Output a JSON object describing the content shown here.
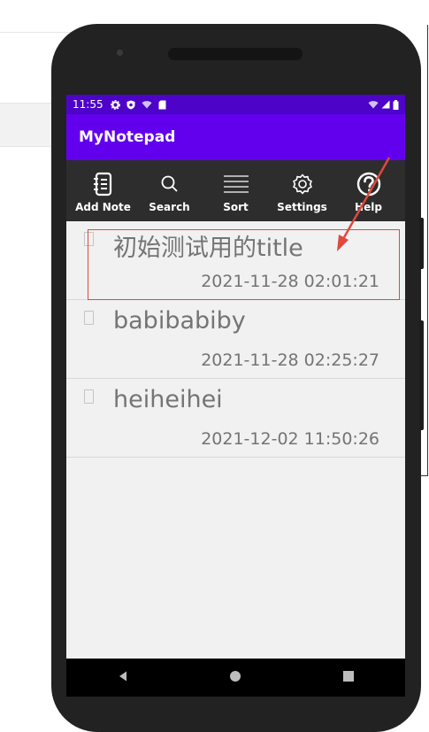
{
  "status_bar": {
    "time": "11:55"
  },
  "app": {
    "title": "MyNotepad"
  },
  "toolbar": {
    "items": [
      {
        "label": "Add Note",
        "icon": "notebook-icon"
      },
      {
        "label": "Search",
        "icon": "search-icon"
      },
      {
        "label": "Sort",
        "icon": "sort-lines-icon"
      },
      {
        "label": "Settings",
        "icon": "gear-icon"
      },
      {
        "label": "Help",
        "icon": "question-icon"
      }
    ]
  },
  "notes": [
    {
      "title": "初始测试用的title",
      "date": "2021-11-28 02:01:21"
    },
    {
      "title": "babibabiby",
      "date": "2021-11-28 02:25:27"
    },
    {
      "title": "heiheihei",
      "date": "2021-12-02 11:50:26"
    }
  ],
  "colors": {
    "status_bar": "#4e03c9",
    "app_bar": "#6200ee",
    "toolbar": "#2d2d2d",
    "annotation": "#e0483e"
  }
}
